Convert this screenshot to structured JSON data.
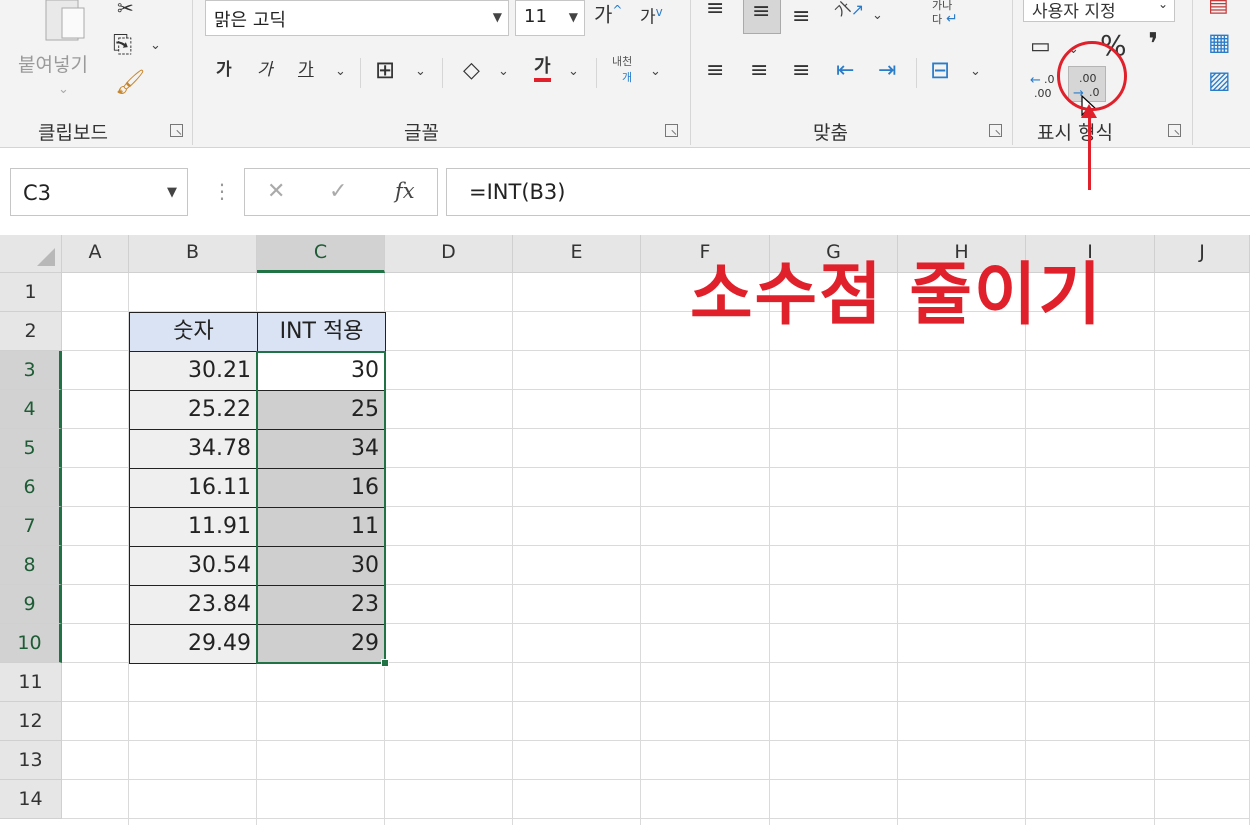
{
  "ribbon": {
    "clipboard": {
      "paste_label": "붙여넣기",
      "group_label": "클립보드"
    },
    "font": {
      "font_name": "맑은 고딕",
      "font_size": "11",
      "grow_label": "가",
      "shrink_label": "가",
      "bold_label": "가",
      "italic_label": "가",
      "underline_label": "가",
      "font_color_label": "가",
      "phonetic_top": "내천",
      "phonetic_bottom": "개",
      "group_label": "글꼴"
    },
    "alignment": {
      "wrap_top": "가나",
      "wrap_bottom": "다",
      "orientation_label": "가",
      "group_label": "맞춤"
    },
    "number": {
      "format_value": "사용자 지정",
      "percent_label": "%",
      "comma_label": "❜",
      "increase_decimal_top": ".0",
      "increase_decimal_bottom": ".00",
      "decrease_decimal_top": ".00",
      "decrease_decimal_bottom": ".0",
      "group_label": "표시 형식"
    }
  },
  "formula_bar": {
    "name_box": "C3",
    "cancel_icon": "✕",
    "enter_icon": "✓",
    "fx_label": "fx",
    "formula": "=INT(B3)"
  },
  "grid": {
    "columns": [
      "A",
      "B",
      "C",
      "D",
      "E",
      "F",
      "G",
      "H",
      "I",
      "J"
    ],
    "rows": [
      "1",
      "2",
      "3",
      "4",
      "5",
      "6",
      "7",
      "8",
      "9",
      "10",
      "11",
      "12",
      "13",
      "14"
    ],
    "selected_column": "C",
    "header_b": "숫자",
    "header_c": "INT 적용",
    "numbers": [
      "30.21",
      "25.22",
      "34.78",
      "16.11",
      "11.91",
      "30.54",
      "23.84",
      "29.49"
    ],
    "int_values": [
      "30",
      "25",
      "34",
      "16",
      "11",
      "30",
      "23",
      "29"
    ]
  },
  "annotation": {
    "text": "소수점 줄이기",
    "color": "#e0202a"
  },
  "colors": {
    "excel_green": "#217346",
    "header_fill": "#dae3f3"
  }
}
